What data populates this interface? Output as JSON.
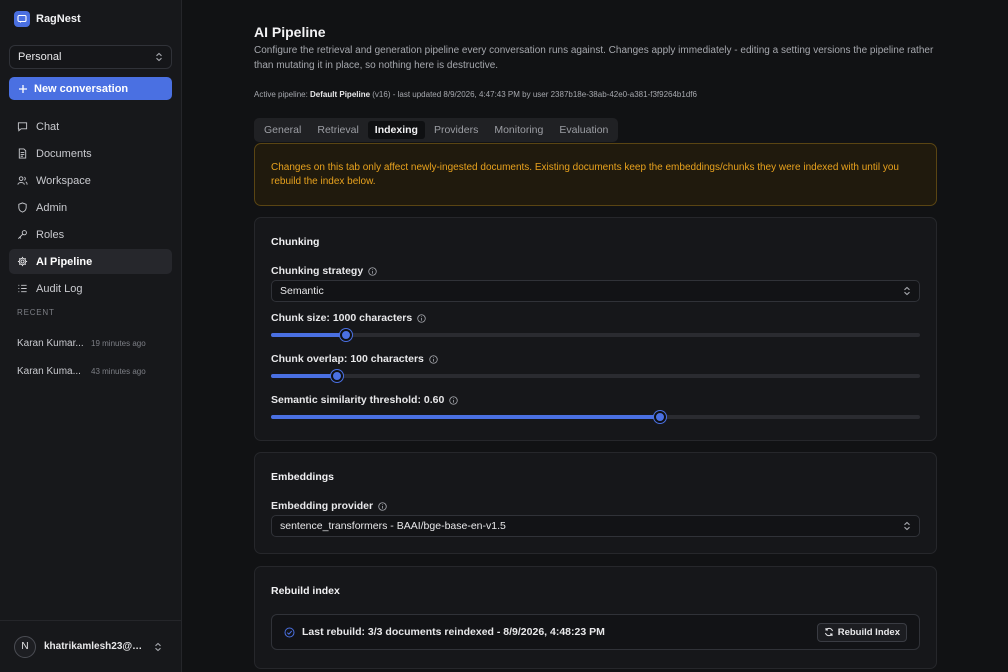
{
  "app": {
    "name": "RagNest",
    "brand_color": "#4a70e2"
  },
  "sidebar": {
    "workspace": "Personal",
    "new_conversation": "New conversation",
    "nav": [
      {
        "label": "Chat",
        "icon": "chat-icon",
        "active": false
      },
      {
        "label": "Documents",
        "icon": "document-icon",
        "active": false
      },
      {
        "label": "Workspace",
        "icon": "users-icon",
        "active": false
      },
      {
        "label": "Admin",
        "icon": "shield-icon",
        "active": false
      },
      {
        "label": "Roles",
        "icon": "key-icon",
        "active": false
      },
      {
        "label": "AI Pipeline",
        "icon": "gear-icon",
        "active": true
      },
      {
        "label": "Audit Log",
        "icon": "list-icon",
        "active": false
      }
    ],
    "recent_label": "RECENT",
    "recent": [
      {
        "title": "Karan Kumar...",
        "time": "19 minutes ago"
      },
      {
        "title": "Karan Kuma...",
        "time": "43 minutes ago"
      }
    ],
    "user": {
      "initial": "N",
      "email": "khatrikamlesh23@g..."
    }
  },
  "page": {
    "title": "AI Pipeline",
    "description": "Configure the retrieval and generation pipeline every conversation runs against. Changes apply immediately - editing a setting versions the pipeline rather than mutating it in place, so nothing here is destructive.",
    "active_prefix": "Active pipeline: ",
    "active_name": "Default Pipeline",
    "active_suffix": " (v16) - last updated 8/9/2026, 4:47:43 PM by user 2387b18e-38ab-42e0-a381-f3f9264b1df6",
    "tabs": [
      "General",
      "Retrieval",
      "Indexing",
      "Providers",
      "Monitoring",
      "Evaluation"
    ],
    "active_tab": "Indexing",
    "warning": "Changes on this tab only affect newly-ingested documents. Existing documents keep the embeddings/chunks they were indexed with until you rebuild the index below.",
    "warning_color": "#e8a21d"
  },
  "chunking": {
    "title": "Chunking",
    "strategy_label": "Chunking strategy",
    "strategy_value": "Semantic",
    "size_label": "Chunk size: 1000 characters",
    "size_fraction": 0.115,
    "overlap_label": "Chunk overlap: 100 characters",
    "overlap_fraction": 0.101,
    "threshold_label": "Semantic similarity threshold: 0.60",
    "threshold_fraction": 0.6
  },
  "embeddings": {
    "title": "Embeddings",
    "provider_label": "Embedding provider",
    "provider_value": "sentence_transformers - BAAI/bge-base-en-v1.5"
  },
  "rebuild": {
    "title": "Rebuild index",
    "status": "Last rebuild: 3/3 documents reindexed - 8/9/2026, 4:48:23 PM",
    "button": "Rebuild Index"
  }
}
